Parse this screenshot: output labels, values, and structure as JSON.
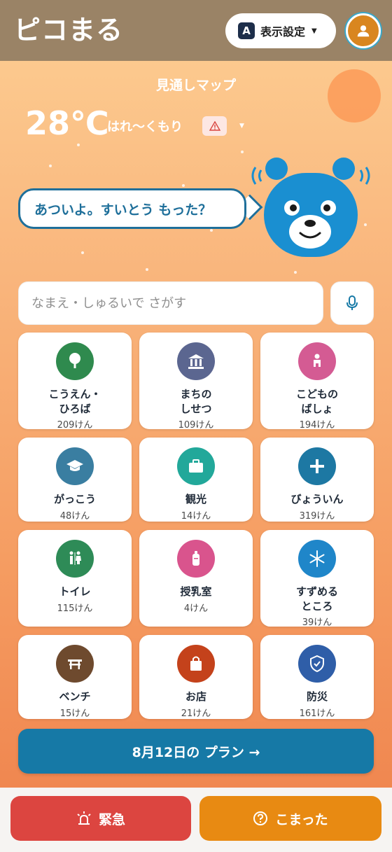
{
  "header": {
    "app_title": "ピコまる",
    "display_button": {
      "badge": "A",
      "label": "表示設定"
    },
    "avatar_icon": "user-icon"
  },
  "hero": {
    "map_title": "見通しマップ",
    "temperature": "28℃",
    "weather": "はれ〜くもり",
    "warning_icon": "alert-triangle-icon",
    "speech": "あついよ。すいとう もった？"
  },
  "search": {
    "placeholder": "なまえ・しゅるいで さがす",
    "value": "",
    "mic_icon": "microphone-icon"
  },
  "categories": [
    {
      "name": "こうえん・\nひろば",
      "count": "209けん",
      "icon": "tree-icon",
      "color": "#2f8a4e"
    },
    {
      "name": "まちの\nしせつ",
      "count": "109けん",
      "icon": "building-icon",
      "color": "#5b6690"
    },
    {
      "name": "こどもの\nばしょ",
      "count": "194けん",
      "icon": "child-icon",
      "color": "#d45b93"
    },
    {
      "name": "がっこう",
      "count": "48けん",
      "icon": "graduation-cap-icon",
      "color": "#3a7ea1"
    },
    {
      "name": "観光",
      "count": "14けん",
      "icon": "suitcase-icon",
      "color": "#22a89a"
    },
    {
      "name": "びょういん",
      "count": "319けん",
      "icon": "plus-icon",
      "color": "#1d78a3"
    },
    {
      "name": "トイレ",
      "count": "115けん",
      "icon": "restroom-icon",
      "color": "#2e8b57"
    },
    {
      "name": "授乳室",
      "count": "4けん",
      "icon": "baby-bottle-icon",
      "color": "#d9548d"
    },
    {
      "name": "すずめる\nところ",
      "count": "39けん",
      "icon": "snowflake-icon",
      "color": "#1f86c9"
    },
    {
      "name": "ベンチ",
      "count": "15けん",
      "icon": "bench-icon",
      "color": "#6e4a2e"
    },
    {
      "name": "お店",
      "count": "21けん",
      "icon": "shopping-bag-icon",
      "color": "#c4421b"
    },
    {
      "name": "防災",
      "count": "161けん",
      "icon": "shield-check-icon",
      "color": "#2f5ea8"
    }
  ],
  "plan_button": {
    "label": "8月12日の プラン →"
  },
  "bottom_bar": {
    "emergency_label": "緊急",
    "emergency_icon": "siren-icon",
    "help_label": "こまった",
    "help_icon": "question-circle-icon"
  },
  "colors": {
    "header_bg": "#9a8366",
    "accent_blue": "#1679a6",
    "emergency_red": "#dc4540",
    "help_orange": "#e88a12"
  }
}
